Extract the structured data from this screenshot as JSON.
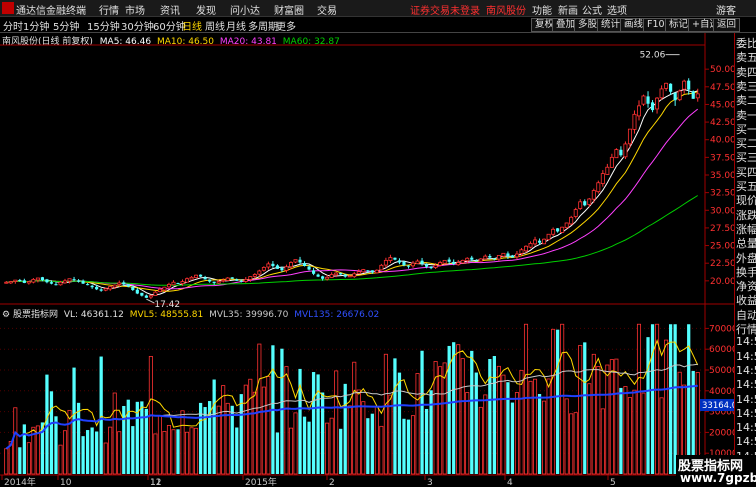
{
  "menubar": {
    "app_title": "通达信金融终端",
    "menus": [
      "行情",
      "市场",
      "资讯",
      "发现",
      "问小达",
      "财富圈",
      "交易"
    ],
    "notice": "证券交易未登录",
    "stock_name": "南风股份",
    "right_items": [
      "功能",
      "新画",
      "公式",
      "选项",
      "游客"
    ]
  },
  "toolbar": {
    "periods": [
      "分时",
      "1分钟",
      "5分钟",
      "15分钟",
      "30分钟",
      "60分钟",
      "日线",
      "周线",
      "月线",
      "多周期",
      "更多"
    ],
    "active_period": "日线",
    "right_buttons": [
      "复权",
      "叠加",
      "多股",
      "统计",
      "画线",
      "F10",
      "标记",
      "+自选",
      "返回"
    ]
  },
  "price_panel": {
    "title": "南风股份(日线 前复权)",
    "ma": [
      {
        "label": "MA5: 46.46",
        "color": "#ffffff"
      },
      {
        "label": "MA10: 46.50",
        "color": "#ffd800"
      },
      {
        "label": "MA20: 43.81",
        "color": "#ff40ff"
      },
      {
        "label": "MA60: 32.87",
        "color": "#00d000"
      }
    ],
    "y_ticks": [
      "50.00",
      "47.50",
      "45.00",
      "42.50",
      "40.00",
      "37.50",
      "35.00",
      "32.50",
      "30.00",
      "27.50",
      "25.00",
      "22.50",
      "20.00"
    ],
    "high_label": "52.06",
    "low_label": "17.42"
  },
  "volume_panel": {
    "title": "股票指标网",
    "vl": "VL: 46361.12",
    "mvl5": "MVL5: 48555.81",
    "mvl35": "MVL35: 39996.70",
    "mvl135": "MVL135: 26676.02",
    "y_ticks": [
      "70000",
      "60000",
      "50000",
      "40000",
      "30000",
      "20000",
      "10000"
    ],
    "current_value": "33164.08"
  },
  "x_axis": [
    "2014年",
    "10",
    "11",
    "12",
    "2015年",
    "2",
    "3",
    "4",
    "5"
  ],
  "right_panel": [
    "委比",
    "卖五",
    "卖四",
    "卖三",
    "卖二",
    "卖一",
    "买一",
    "买二",
    "买三",
    "买四",
    "买五",
    "现价",
    "涨跌",
    "涨幅",
    "总量",
    "外盘",
    "换手",
    "净资",
    "收益",
    "自动",
    "行情",
    "14:5",
    "14:5",
    "14:5",
    "14:5",
    "14:5",
    "14:5",
    "14:5",
    "14:5",
    "14:5",
    "14:5"
  ],
  "watermark": {
    "line1": "股票指标网",
    "line2": "www.7gpzb.com"
  },
  "chart_data": {
    "type": "candlestick",
    "price_range": [
      17.0,
      53.0
    ],
    "volume_range": [
      0,
      75000
    ],
    "closes": [
      19.8,
      19.9,
      20.1,
      20.0,
      19.7,
      19.9,
      20.2,
      20.4,
      20.1,
      19.8,
      19.6,
      19.5,
      19.8,
      20.0,
      20.3,
      20.1,
      19.9,
      19.6,
      19.4,
      19.1,
      18.8,
      18.6,
      18.9,
      19.2,
      19.4,
      19.7,
      19.5,
      19.2,
      18.7,
      18.2,
      17.9,
      17.6,
      17.9,
      18.4,
      18.8,
      19.1,
      19.5,
      19.8,
      19.6,
      19.9,
      20.3,
      20.5,
      20.8,
      20.6,
      20.2,
      19.9,
      19.7,
      19.9,
      20.1,
      20.4,
      20.3,
      20.0,
      19.9,
      20.2,
      20.6,
      20.9,
      21.4,
      21.9,
      22.4,
      22.1,
      21.7,
      21.5,
      22.0,
      22.6,
      23.0,
      22.6,
      22.1,
      21.6,
      21.0,
      20.6,
      20.3,
      20.5,
      20.9,
      21.1,
      20.9,
      20.6,
      20.7,
      21.0,
      21.3,
      21.6,
      21.4,
      21.2,
      21.5,
      22.2,
      22.9,
      23.3,
      23.0,
      22.6,
      22.2,
      22.1,
      22.5,
      22.8,
      22.4,
      22.0,
      21.8,
      22.2,
      22.6,
      22.9,
      22.7,
      22.4,
      22.6,
      22.9,
      23.2,
      23.0,
      22.8,
      23.1,
      23.5,
      23.3,
      23.1,
      23.6,
      23.9,
      23.5,
      23.3,
      23.8,
      24.4,
      24.9,
      25.3,
      25.8,
      25.4,
      25.9,
      26.6,
      27.3,
      27.0,
      27.6,
      28.2,
      29.0,
      30.1,
      31.2,
      30.7,
      31.6,
      32.8,
      33.9,
      35.2,
      36.1,
      37.5,
      38.6,
      37.8,
      39.4,
      41.5,
      43.6,
      44.8,
      46.2,
      45.1,
      44.2,
      45.9,
      47.2,
      48.0,
      46.8,
      45.6,
      46.9,
      48.3,
      47.1,
      45.8,
      46.5
    ]
  }
}
